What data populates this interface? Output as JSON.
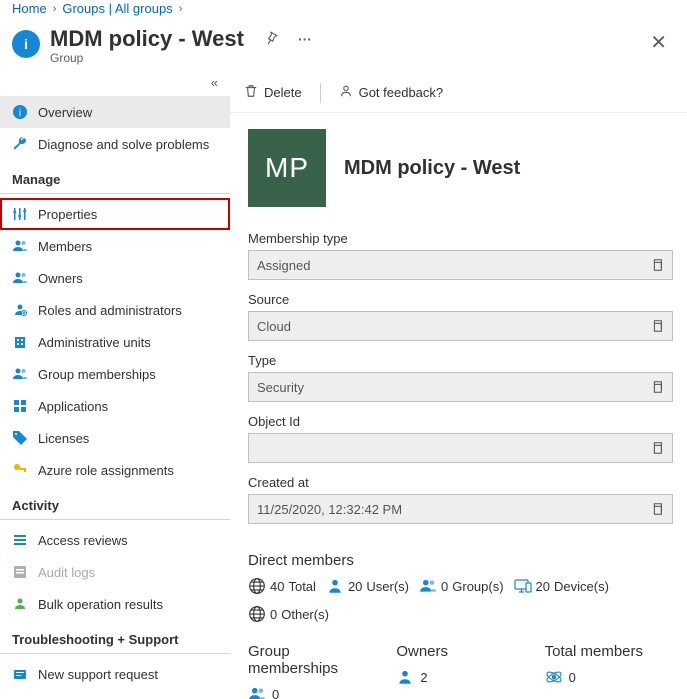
{
  "breadcrumb": {
    "home": "Home",
    "groups": "Groups | All groups"
  },
  "header": {
    "title": "MDM policy - West",
    "subtype": "Group"
  },
  "sidebar": {
    "overview": "Overview",
    "diagnose": "Diagnose and solve problems",
    "manage_header": "Manage",
    "properties": "Properties",
    "members": "Members",
    "owners": "Owners",
    "roles": "Roles and administrators",
    "admin_units": "Administrative units",
    "group_memberships": "Group memberships",
    "applications": "Applications",
    "licenses": "Licenses",
    "azure_roles": "Azure role assignments",
    "activity_header": "Activity",
    "access_reviews": "Access reviews",
    "audit_logs": "Audit logs",
    "bulk_ops": "Bulk operation results",
    "support_header": "Troubleshooting + Support",
    "new_request": "New support request"
  },
  "toolbar": {
    "delete": "Delete",
    "feedback": "Got feedback?"
  },
  "entity": {
    "initials": "MP",
    "name": "MDM policy - West"
  },
  "fields": {
    "membership_type": {
      "label": "Membership type",
      "value": "Assigned"
    },
    "source": {
      "label": "Source",
      "value": "Cloud"
    },
    "type": {
      "label": "Type",
      "value": "Security"
    },
    "object_id": {
      "label": "Object Id",
      "value": ""
    },
    "created_at": {
      "label": "Created at",
      "value": "11/25/2020, 12:32:42 PM"
    }
  },
  "direct_members": {
    "title": "Direct members",
    "total": {
      "count": "40",
      "suffix": "Total"
    },
    "users": {
      "count": "20",
      "suffix": "User(s)"
    },
    "groups": {
      "count": "0",
      "suffix": "Group(s)"
    },
    "devices": {
      "count": "20",
      "suffix": "Device(s)"
    },
    "others": {
      "count": "0",
      "suffix": "Other(s)"
    }
  },
  "summary": {
    "group_memberships": {
      "title": "Group memberships",
      "count": "0"
    },
    "owners": {
      "title": "Owners",
      "count": "2"
    },
    "total_members": {
      "title": "Total members",
      "count": "0"
    }
  }
}
